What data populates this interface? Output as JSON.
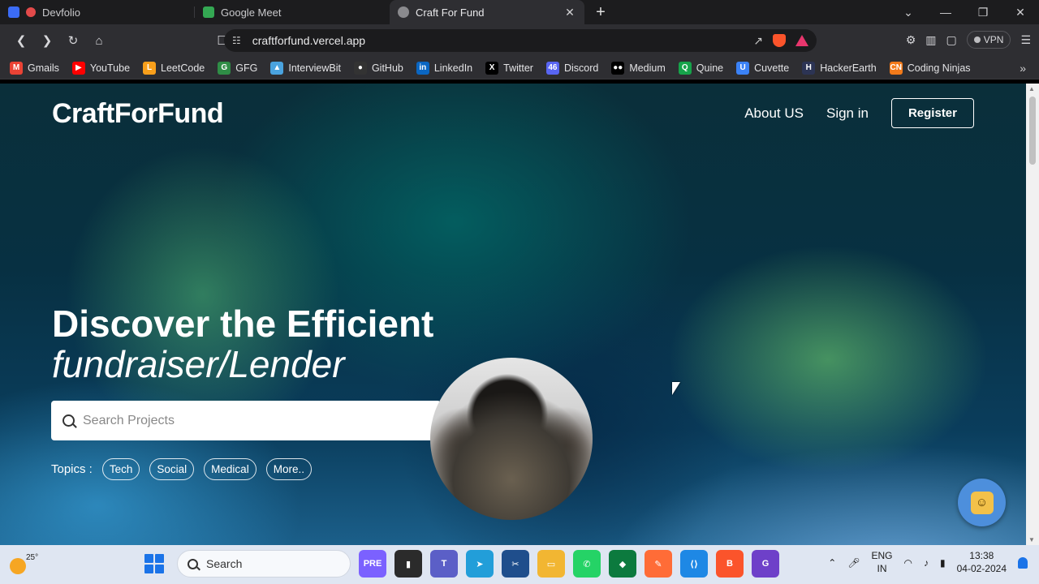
{
  "browser": {
    "tabs": [
      {
        "title": "Devfolio",
        "favicon_color": "#3b6cf6",
        "active": false
      },
      {
        "title": "Google Meet",
        "favicon_color": "#34a853",
        "active": false
      },
      {
        "title": "Craft For Fund",
        "favicon_color": "#8a8a8e",
        "active": true
      }
    ],
    "close_glyph": "✕",
    "new_tab_glyph": "+",
    "window_controls": {
      "chevron": "⌄",
      "minimize": "—",
      "restore": "❐",
      "close": "✕"
    },
    "url": "craftforfund.vercel.app",
    "vpn_label": "VPN"
  },
  "bookmarks": [
    {
      "label": "Gmails",
      "icon": "M",
      "color": "#ea4335"
    },
    {
      "label": "YouTube",
      "icon": "▶",
      "color": "#ff0000"
    },
    {
      "label": "LeetCode",
      "icon": "L",
      "color": "#f89f1b"
    },
    {
      "label": "GFG",
      "icon": "G",
      "color": "#2f8d46"
    },
    {
      "label": "InterviewBit",
      "icon": "▲",
      "color": "#4aa3df"
    },
    {
      "label": "GitHub",
      "icon": "●",
      "color": "#333333"
    },
    {
      "label": "LinkedIn",
      "icon": "in",
      "color": "#0a66c2"
    },
    {
      "label": "Twitter",
      "icon": "X",
      "color": "#000000"
    },
    {
      "label": "Discord",
      "icon": "46",
      "color": "#5865f2"
    },
    {
      "label": "Medium",
      "icon": "●●",
      "color": "#000000"
    },
    {
      "label": "Quine",
      "icon": "Q",
      "color": "#16a34a"
    },
    {
      "label": "Cuvette",
      "icon": "U",
      "color": "#3b82f6"
    },
    {
      "label": "HackerEarth",
      "icon": "H",
      "color": "#2c3454"
    },
    {
      "label": "Coding Ninjas",
      "icon": "CN",
      "color": "#f27a1a"
    }
  ],
  "bookmarks_more": "»",
  "site": {
    "logo": "CraftForFund",
    "nav": {
      "about": "About US",
      "signin": "Sign in",
      "register": "Register"
    },
    "hero_title": "Discover the Efficient",
    "hero_subtitle": "fundraiser/Lender",
    "search_placeholder": "Search Projects",
    "topics_label": "Topics :",
    "topics": [
      "Tech",
      "Social",
      "Medical",
      "More.."
    ]
  },
  "taskbar": {
    "temperature": "25°",
    "search_label": "Search",
    "apps": [
      {
        "name": "copilot",
        "label": "PRE",
        "color": "#7b61ff"
      },
      {
        "name": "terminal",
        "label": "▮",
        "color": "#2b2b2b"
      },
      {
        "name": "teams",
        "label": "T",
        "color": "#5b5fc7"
      },
      {
        "name": "telegram",
        "label": "➤",
        "color": "#229ed9"
      },
      {
        "name": "snipping",
        "label": "✂",
        "color": "#1f4e8c"
      },
      {
        "name": "explorer",
        "label": "▭",
        "color": "#f2b632"
      },
      {
        "name": "whatsapp",
        "label": "✆",
        "color": "#25d366"
      },
      {
        "name": "mongodb",
        "label": "◆",
        "color": "#0c7a3e"
      },
      {
        "name": "postman",
        "label": "✎",
        "color": "#ff6c37"
      },
      {
        "name": "vscode",
        "label": "⟨⟩",
        "color": "#1e88e5"
      },
      {
        "name": "brave",
        "label": "B",
        "color": "#fb542b"
      },
      {
        "name": "github",
        "label": "G",
        "color": "#6e40c9"
      }
    ],
    "lang_line1": "ENG",
    "lang_line2": "IN",
    "time": "13:38",
    "date": "04-02-2024"
  }
}
